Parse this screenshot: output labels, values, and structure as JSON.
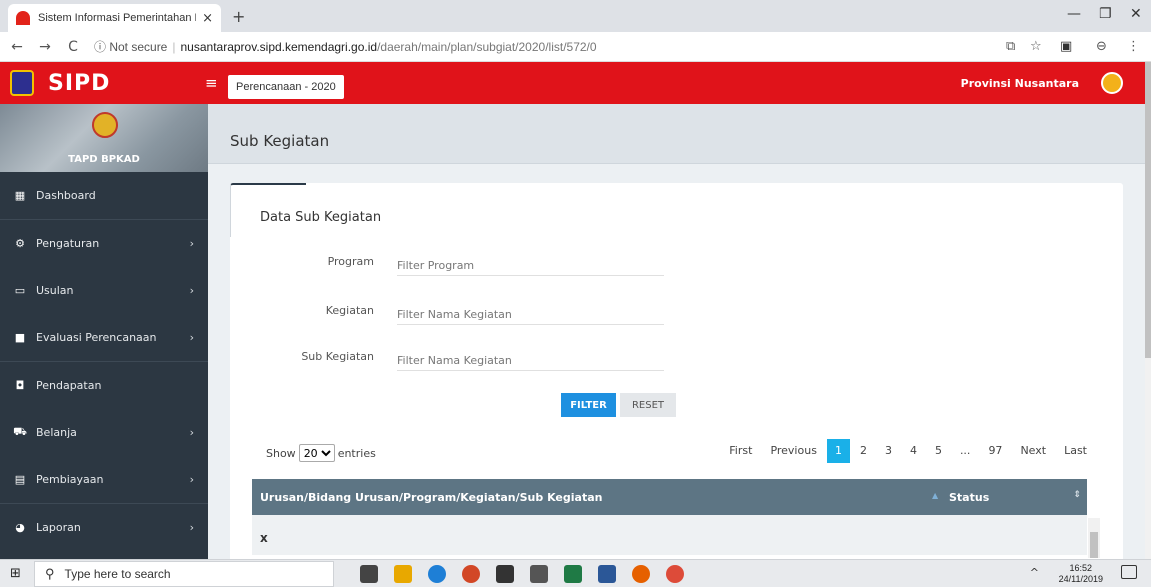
{
  "browser": {
    "tab_title": "Sistem Informasi Pemerintahan D",
    "tab_close": "×",
    "new_tab": "+",
    "security": "ⓘ Not secure",
    "url_host": "nusantaraprov.sipd.kemendagri.go.id",
    "url_path": "/daerah/main/plan/subgiat/2020/list/572/0"
  },
  "header": {
    "brand": "SIPD",
    "hamburger": "≡",
    "periode_label": "Perencanaan - 2020",
    "province": "Provinsi Nusantara"
  },
  "sidebar": {
    "user": "TAPD BPKAD",
    "items": [
      {
        "label": "Dashboard",
        "icon": "dashboard-icon",
        "chevron": ""
      },
      {
        "label": "Pengaturan",
        "icon": "gear-icon",
        "chevron": "›"
      },
      {
        "label": "Usulan",
        "icon": "chat-icon",
        "chevron": "›"
      },
      {
        "label": "Evaluasi Perencanaan",
        "icon": "bookmark-icon",
        "chevron": "›"
      },
      {
        "label": "Pendapatan",
        "icon": "wallet-icon",
        "chevron": ""
      },
      {
        "label": "Belanja",
        "icon": "cart-icon",
        "chevron": "›"
      },
      {
        "label": "Pembiayaan",
        "icon": "calculator-icon",
        "chevron": "›"
      },
      {
        "label": "Laporan",
        "icon": "pie-chart-icon",
        "chevron": "›"
      }
    ]
  },
  "page": {
    "title": "Sub Kegiatan",
    "card_title": "Data Sub Kegiatan"
  },
  "filters": {
    "program_label": "Program",
    "program_placeholder": "Filter Program",
    "kegiatan_label": "Kegiatan",
    "kegiatan_placeholder": "Filter Nama Kegiatan",
    "subkegiatan_label": "Sub Kegiatan",
    "subkegiatan_placeholder": "Filter Nama Kegiatan",
    "filter_button": "FILTER",
    "reset_button": "RESET"
  },
  "table": {
    "show_label": "Show",
    "entries_value": "20",
    "entries_label": "entries",
    "pagination": [
      "First",
      "Previous",
      "1",
      "2",
      "3",
      "4",
      "5",
      "...",
      "97",
      "Next",
      "Last"
    ],
    "active_page": "1",
    "columns": [
      "Urusan/Bidang Urusan/Program/Kegiatan/Sub Kegiatan",
      "Status"
    ],
    "rows": [
      [
        "x",
        ""
      ]
    ]
  },
  "taskbar": {
    "search_placeholder": "Type here to search",
    "time": "16:52",
    "date": "24/11/2019"
  }
}
